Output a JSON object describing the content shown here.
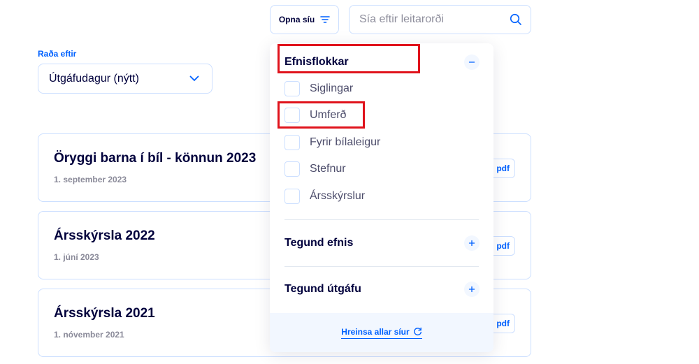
{
  "toolbar": {
    "filter_button_label": "Opna síu",
    "search_placeholder": "Sía eftir leitarorði"
  },
  "sort": {
    "label": "Raða eftir",
    "selected": "Útgáfudagur (nýtt)"
  },
  "publications": [
    {
      "title": "Öryggi barna í bíl - könnun 2023",
      "date": "1. september 2023",
      "tag": "pdf"
    },
    {
      "title": "Ársskýrsla 2022",
      "date": "1. júní 2023",
      "tag": "pdf"
    },
    {
      "title": "Ársskýrsla 2021",
      "date": "1. nóvember 2021",
      "tag": "pdf"
    }
  ],
  "filter_panel": {
    "groups": [
      {
        "title": "Efnisflokkar",
        "expanded": true,
        "options": [
          "Siglingar",
          "Umferð",
          "Fyrir bílaleigur",
          "Stefnur",
          "Ársskýrslur"
        ]
      },
      {
        "title": "Tegund efnis",
        "expanded": false
      },
      {
        "title": "Tegund útgáfu",
        "expanded": false
      }
    ],
    "clear_label": "Hreinsa allar síur"
  },
  "colors": {
    "accent": "#0061ff",
    "text": "#00003c",
    "border": "#ccdfff",
    "highlight": "#e0131c"
  }
}
